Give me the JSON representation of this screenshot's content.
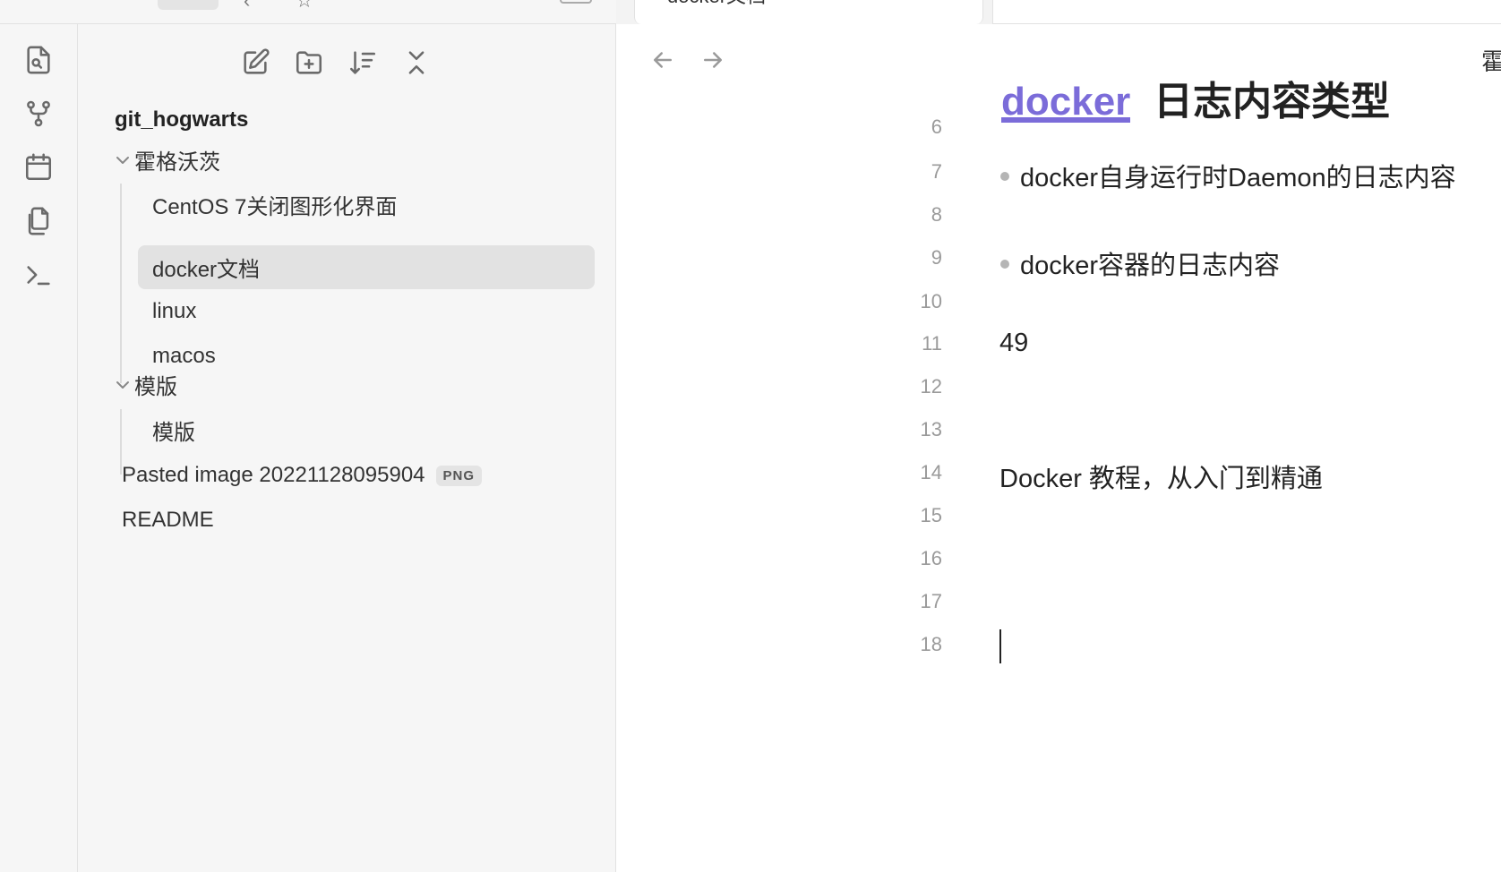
{
  "tab": {
    "title": "docker文档"
  },
  "explorer": {
    "vault_name": "git_hogwarts",
    "tree": [
      {
        "label": "霍格沃茨",
        "type": "folder",
        "expanded": true
      },
      {
        "label": "CentOS 7关闭图形化界面",
        "type": "file"
      },
      {
        "label": "docker文档",
        "type": "file",
        "selected": true
      },
      {
        "label": "linux",
        "type": "file"
      },
      {
        "label": "macos",
        "type": "file"
      },
      {
        "label": "模版",
        "type": "folder",
        "expanded": true
      },
      {
        "label": "模版",
        "type": "file"
      },
      {
        "label": "Pasted image 20221128095904",
        "type": "file",
        "badge": "PNG"
      },
      {
        "label": "README",
        "type": "file"
      }
    ]
  },
  "editor": {
    "breadcrumb": "霍",
    "heading_link": "docker",
    "heading_rest": "日志内容类型",
    "lines": [
      {
        "num": "6",
        "text": ""
      },
      {
        "num": "7",
        "text": "docker自身运行时Daemon的日志内容",
        "bullet": true
      },
      {
        "num": "8",
        "text": ""
      },
      {
        "num": "9",
        "text": "docker容器的日志内容",
        "bullet": true
      },
      {
        "num": "10",
        "text": ""
      },
      {
        "num": "11",
        "text": "49"
      },
      {
        "num": "12",
        "text": ""
      },
      {
        "num": "13",
        "text": ""
      },
      {
        "num": "14",
        "text": "Docker 教程，从入门到精通"
      },
      {
        "num": "15",
        "text": ""
      },
      {
        "num": "16",
        "text": ""
      },
      {
        "num": "17",
        "text": ""
      },
      {
        "num": "18",
        "text": ""
      }
    ]
  },
  "icons": {
    "ribbon": [
      "file-search-icon",
      "git-branch-icon",
      "calendar-icon",
      "copy-files-icon",
      "terminal-icon"
    ],
    "explorer_toolbar": [
      "new-note-icon",
      "new-folder-icon",
      "sort-icon",
      "collapse-all-icon"
    ],
    "nav": [
      "arrow-left-icon",
      "arrow-right-icon"
    ]
  },
  "colors": {
    "accent": "#7b6cd9",
    "sidebar_bg": "#f6f6f6",
    "selected_bg": "#e2e2e2"
  }
}
